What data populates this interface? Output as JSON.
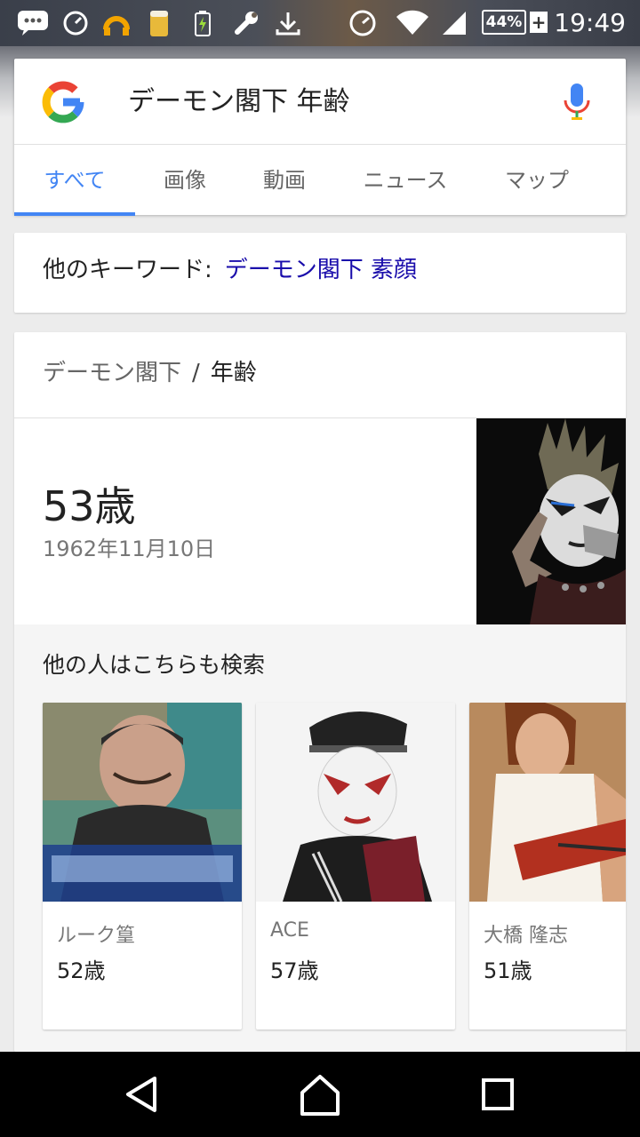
{
  "status_bar": {
    "time": "19:49",
    "battery": "44%",
    "battery_plus": "+",
    "icons": [
      "chat-bubble-icon",
      "speedometer-icon",
      "headset-icon",
      "beer-icon",
      "battery-charging-icon",
      "wrench-icon",
      "download-icon",
      "speedometer-icon",
      "wifi-icon",
      "signal-icon"
    ]
  },
  "search": {
    "query": "デーモン閣下 年齢",
    "tabs": [
      "すべて",
      "画像",
      "動画",
      "ニュース",
      "マップ"
    ],
    "active_tab": 0
  },
  "keywords": {
    "label": "他のキーワード:",
    "link": "デーモン閣下 素顔"
  },
  "answer": {
    "breadcrumb_entity": "デーモン閣下",
    "breadcrumb_sep": "/",
    "breadcrumb_attr": "年齢",
    "age": "53歳",
    "birthdate": "1962年11月10日"
  },
  "related": {
    "title": "他の人はこちらも検索",
    "people": [
      {
        "name": "ルーク篁",
        "age": "52歳"
      },
      {
        "name": "ACE",
        "age": "57歳"
      },
      {
        "name": "大橋 隆志",
        "age": "51歳"
      }
    ]
  },
  "colors": {
    "accent": "#4285f4",
    "link": "#1a0dab"
  }
}
